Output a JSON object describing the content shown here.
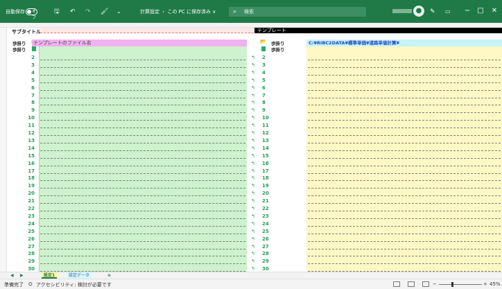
{
  "titlebar": {
    "autosave": "自動保存",
    "toggle": "オフ",
    "doc_title": "計算設定 ・ この PC に保存済み ∨",
    "search_placeholder": "検索",
    "minimize": "−",
    "maximize": "□",
    "close": "✕"
  },
  "sheet": {
    "subtitle_label": "サブタイトル",
    "template_label": "テンプレート",
    "left_label_1": "歩掛り",
    "left_label_2": "歩掛り",
    "file_name_header": "テンプレートのファイル名",
    "right_label_1": "歩掛り",
    "right_label_2": "歩掛り",
    "path_header": "C:¥RIBC2DATA¥標準単価¥道路単価計算¥",
    "row_numbers": [
      "2",
      "3",
      "4",
      "5",
      "6",
      "7",
      "8",
      "9",
      "10",
      "11",
      "12",
      "13",
      "14",
      "15",
      "16",
      "17",
      "18",
      "19",
      "20",
      "21",
      "22",
      "23",
      "24",
      "25",
      "26",
      "27",
      "28",
      "29",
      "30"
    ]
  },
  "tabs": [
    {
      "label": "設定1",
      "active": true
    },
    {
      "label": "設定データ",
      "active": false
    },
    {
      "label": "⊕",
      "active": false
    }
  ],
  "status": {
    "ready": "準備完了",
    "accessibility": "アクセシビリティ: 検討が必要です",
    "zoom": "45%"
  },
  "colors": {
    "title_bar": "#1f7a47",
    "file_area": "#cdf2cd",
    "path_area": "#fff8c4",
    "file_header": "#efb2ef",
    "path_header": "#c7f4f7"
  }
}
